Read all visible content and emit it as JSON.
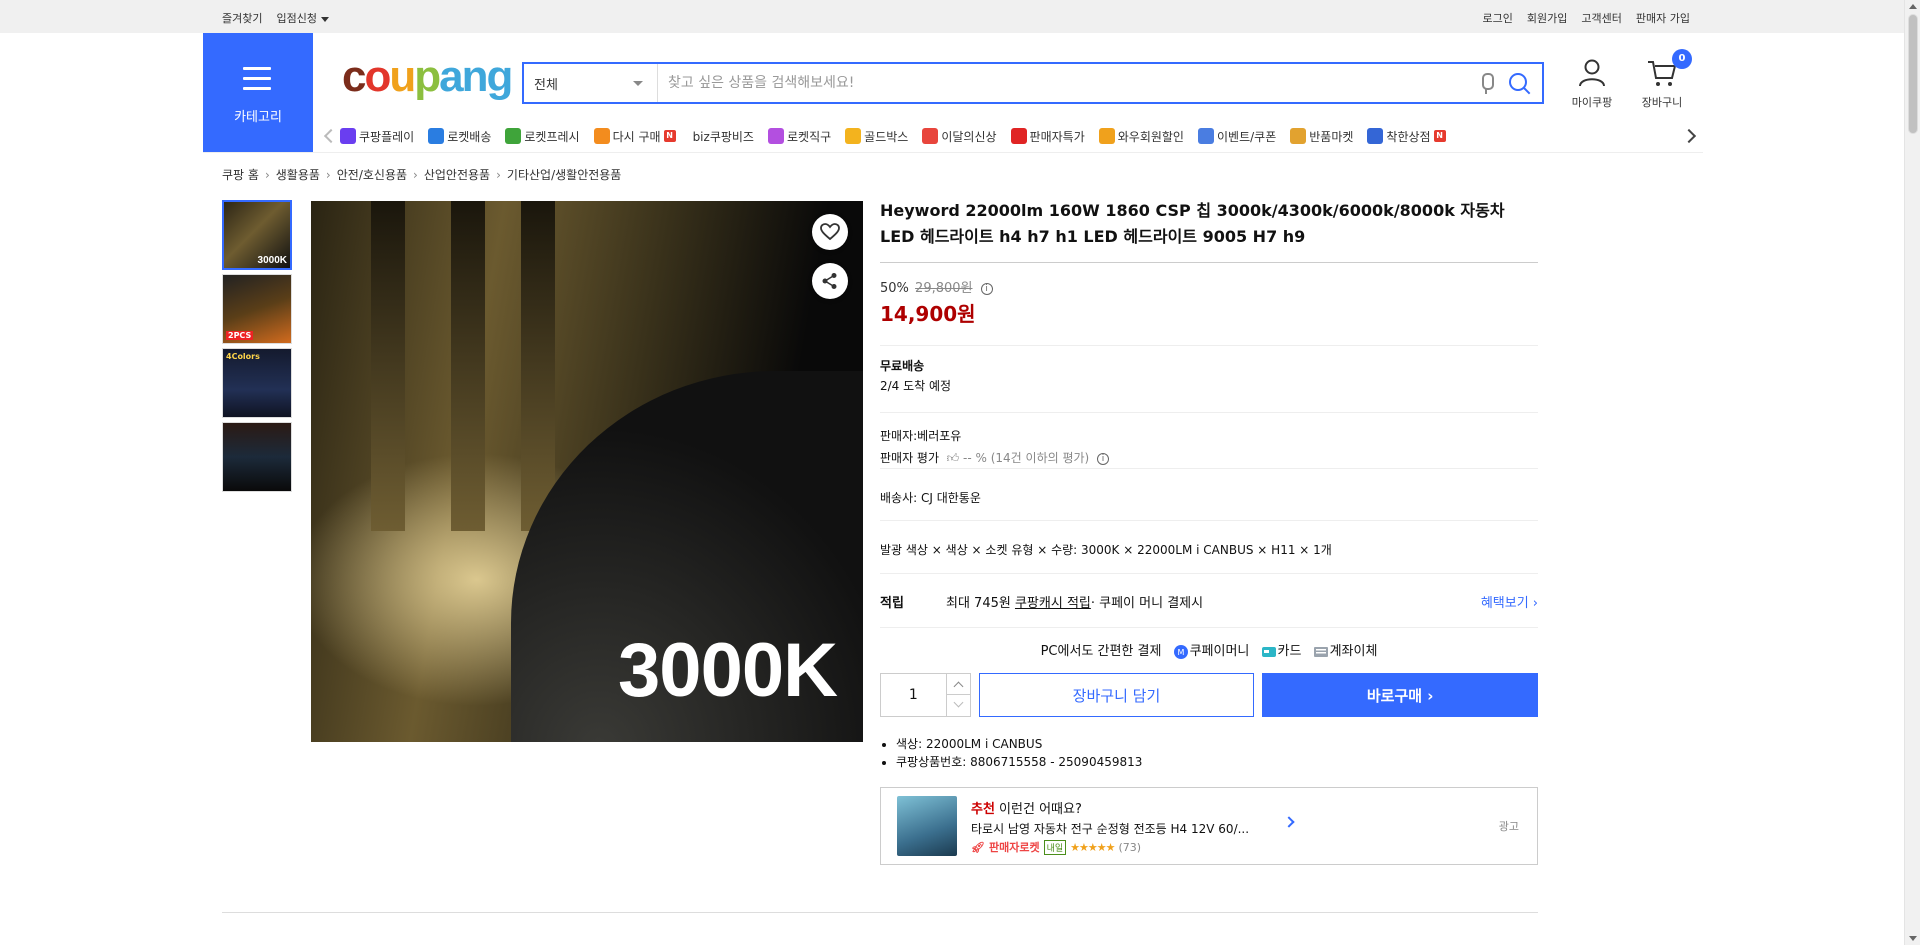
{
  "topbar": {
    "left": [
      "즐겨찾기",
      "입점신청"
    ],
    "right": [
      "로그인",
      "회원가입",
      "고객센터",
      "판매자 가입"
    ]
  },
  "category": {
    "label": "카테고리"
  },
  "logo": {
    "parts": [
      "c",
      "o",
      "u",
      "p",
      "ang"
    ]
  },
  "search": {
    "scope": "전체",
    "placeholder": "찾고 싶은 상품을 검색해보세요!"
  },
  "user": {
    "my_label": "마이쿠팡",
    "cart_label": "장바구니",
    "cart_count": "0"
  },
  "nav": {
    "items": [
      {
        "label": "쿠팡플레이",
        "icon": "play-icon",
        "color": "#6a3ef0"
      },
      {
        "label": "로켓배송",
        "icon": "rocket-icon",
        "color": "#2a7de1"
      },
      {
        "label": "로켓프레시",
        "icon": "rocket-fresh-icon",
        "color": "#3fa43a"
      },
      {
        "label": "다시 구매",
        "icon": "basket-icon",
        "color": "#f38c1e",
        "badge": "N"
      },
      {
        "label": "biz쿠팡비즈",
        "icon": "biz-icon",
        "color": "#ffffff"
      },
      {
        "label": "로켓직구",
        "icon": "globe-icon",
        "color": "#b34fe0"
      },
      {
        "label": "골드박스",
        "icon": "gold-box-icon",
        "color": "#f3b31e"
      },
      {
        "label": "이달의신상",
        "icon": "new-bag-icon",
        "color": "#e8453c"
      },
      {
        "label": "판매자특가",
        "icon": "percent-icon",
        "color": "#e02424"
      },
      {
        "label": "와우회원할인",
        "icon": "wow-icon",
        "color": "#f0a11c"
      },
      {
        "label": "이벤트/쿠폰",
        "icon": "coupon-icon",
        "color": "#4a7de1"
      },
      {
        "label": "반품마켓",
        "icon": "market-icon",
        "color": "#e2a22f"
      },
      {
        "label": "착한상점",
        "icon": "shop-icon",
        "color": "#3466d6",
        "badge": "N"
      }
    ]
  },
  "breadcrumb": [
    "쿠팡 홈",
    "생활용품",
    "안전/호신용품",
    "산업안전용품",
    "기타산업/생활안전용품"
  ],
  "gallery": {
    "thumb_label": "3000K",
    "thumb2_label": "2PCS",
    "thumb3_label": "4Colors",
    "main_label": "3000K"
  },
  "product": {
    "title": "Heyword 22000lm 160W 1860 CSP 칩 3000k/4300k/6000k/8000k 자동차 LED 헤드라이트 h4 h7 h1 LED 헤드라이트 9005 H7 h9",
    "discount_rate": "50%",
    "original_price": "29,800원",
    "sale_price": "14,900원",
    "shipping_title": "무료배송",
    "delivery_date": "2/4 도착 예정",
    "seller": "판매자:베러포유",
    "seller_rating_label": "판매자 평가",
    "seller_rating_value": "-- % (14건 이하의 평가)",
    "carrier": "배송사:  CJ 대한통운",
    "option_summary": "발광 색상 × 색상 × 소켓 유형 × 수량: 3000K × 22000LM i CANBUS × H11 × 1개",
    "reward_label": "적립",
    "reward_text": "최대 745원",
    "reward_link": "쿠팡캐시 적립",
    "reward_suffix": " · 쿠페이 머니 결제시",
    "reward_more": "혜택보기",
    "pay_text": "PC에서도 간편한 결제",
    "pay_methods": [
      "쿠페이머니",
      "카드",
      "계좌이체"
    ],
    "quantity": "1",
    "cart_button": "장바구니 담기",
    "buy_button": "바로구매",
    "bullets": [
      "색상: 22000LM i CANBUS",
      "쿠팡상품번호: 8806715558 - 25090459813"
    ]
  },
  "reco": {
    "prefix": "추천",
    "title": " 이런건 어때요?",
    "name": "타로시 남영 자동차 전구 순정형 전조등 H4 12V 60/...",
    "rocket": "판매자로켓",
    "tag": "내일",
    "stars": "★★★★★",
    "count": "(73)",
    "ad": "광고"
  }
}
